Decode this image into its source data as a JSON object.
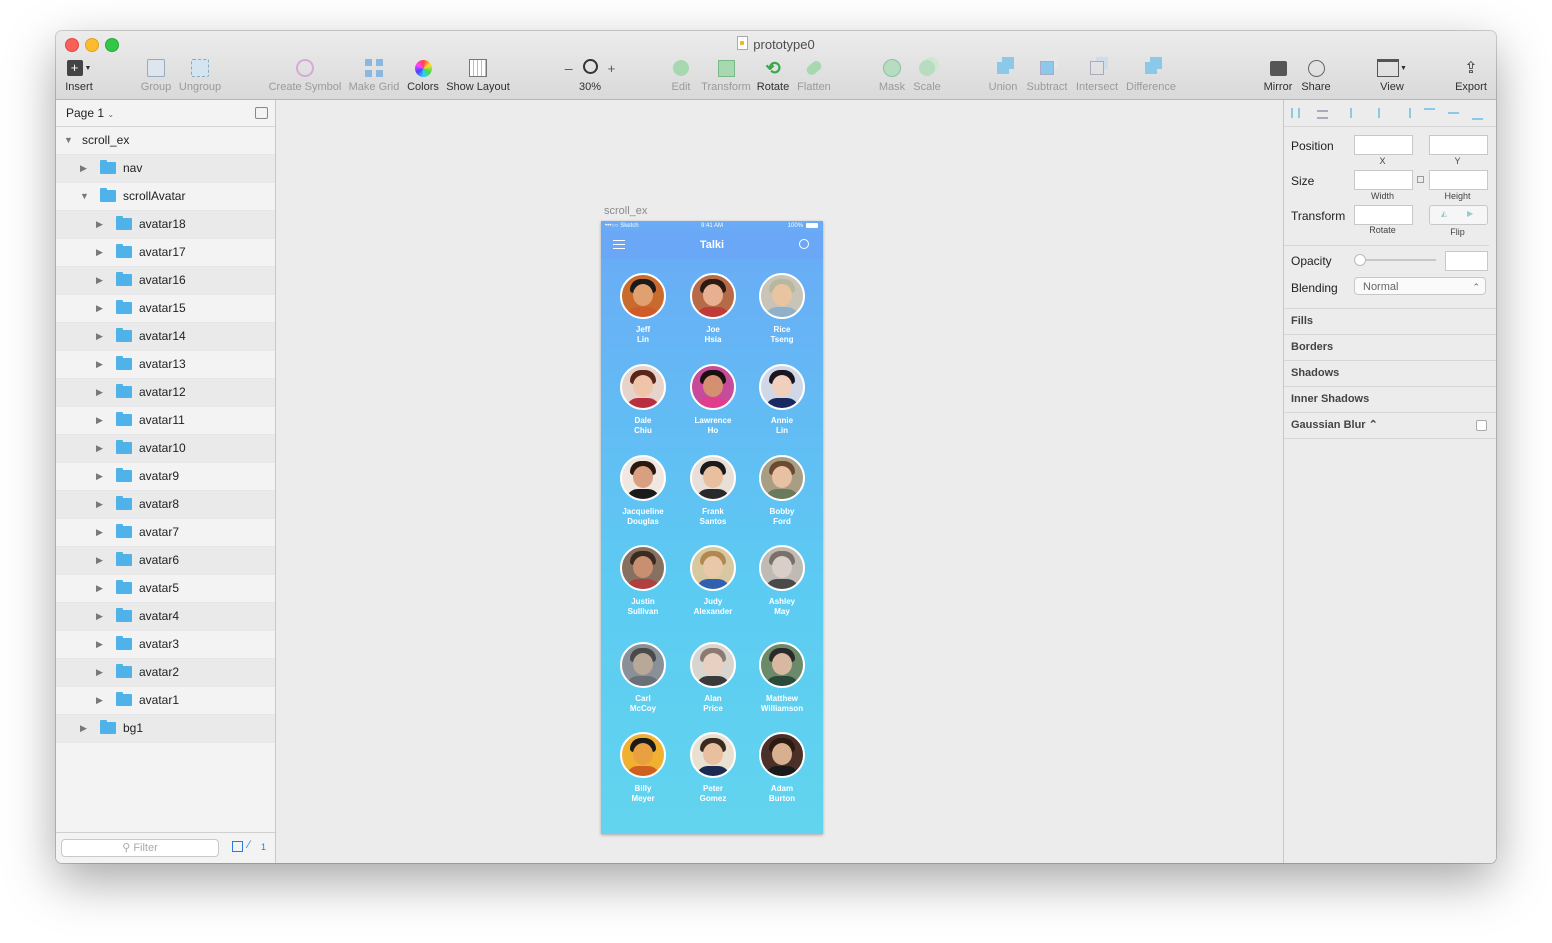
{
  "window": {
    "title": "prototype0"
  },
  "toolbar": {
    "insert": "Insert",
    "group": "Group",
    "ungroup": "Ungroup",
    "create_symbol": "Create Symbol",
    "make_grid": "Make Grid",
    "colors": "Colors",
    "show_layout": "Show Layout",
    "zoom_minus": "–",
    "zoom_plus": "+",
    "zoom": "30%",
    "edit": "Edit",
    "transform": "Transform",
    "rotate": "Rotate",
    "flatten": "Flatten",
    "mask": "Mask",
    "scale": "Scale",
    "union": "Union",
    "subtract": "Subtract",
    "intersect": "Intersect",
    "difference": "Difference",
    "mirror": "Mirror",
    "share": "Share",
    "view": "View",
    "export": "Export"
  },
  "sidebar": {
    "page": "Page 1",
    "layers": [
      {
        "name": "scroll_ex",
        "level": 0,
        "expanded": true,
        "folder": false
      },
      {
        "name": "nav",
        "level": 1,
        "expanded": false,
        "folder": true
      },
      {
        "name": "scrollAvatar",
        "level": 1,
        "expanded": true,
        "folder": true
      },
      {
        "name": "avatar18",
        "level": 2,
        "expanded": false,
        "folder": true
      },
      {
        "name": "avatar17",
        "level": 2,
        "expanded": false,
        "folder": true
      },
      {
        "name": "avatar16",
        "level": 2,
        "expanded": false,
        "folder": true
      },
      {
        "name": "avatar15",
        "level": 2,
        "expanded": false,
        "folder": true
      },
      {
        "name": "avatar14",
        "level": 2,
        "expanded": false,
        "folder": true
      },
      {
        "name": "avatar13",
        "level": 2,
        "expanded": false,
        "folder": true
      },
      {
        "name": "avatar12",
        "level": 2,
        "expanded": false,
        "folder": true
      },
      {
        "name": "avatar11",
        "level": 2,
        "expanded": false,
        "folder": true
      },
      {
        "name": "avatar10",
        "level": 2,
        "expanded": false,
        "folder": true
      },
      {
        "name": "avatar9",
        "level": 2,
        "expanded": false,
        "folder": true
      },
      {
        "name": "avatar8",
        "level": 2,
        "expanded": false,
        "folder": true
      },
      {
        "name": "avatar7",
        "level": 2,
        "expanded": false,
        "folder": true
      },
      {
        "name": "avatar6",
        "level": 2,
        "expanded": false,
        "folder": true
      },
      {
        "name": "avatar5",
        "level": 2,
        "expanded": false,
        "folder": true
      },
      {
        "name": "avatar4",
        "level": 2,
        "expanded": false,
        "folder": true
      },
      {
        "name": "avatar3",
        "level": 2,
        "expanded": false,
        "folder": true
      },
      {
        "name": "avatar2",
        "level": 2,
        "expanded": false,
        "folder": true
      },
      {
        "name": "avatar1",
        "level": 2,
        "expanded": false,
        "folder": true
      },
      {
        "name": "bg1",
        "level": 1,
        "expanded": false,
        "folder": true
      }
    ],
    "filter_placeholder": "Filter",
    "badge_count": "1"
  },
  "canvas": {
    "artboard_name": "scroll_ex",
    "status": {
      "carrier": "•••○○ Sketch",
      "time": "9:41 AM",
      "battery": "100%"
    },
    "app_title": "Talki",
    "contacts": [
      {
        "first": "Jeff",
        "last": "Lin",
        "skin": "#e0a070",
        "hair": "#1a1a1a",
        "shirt": "#d05a2a",
        "bg": "#c86b2d"
      },
      {
        "first": "Joe",
        "last": "Hsia",
        "skin": "#e8b090",
        "hair": "#2a1a12",
        "shirt": "#c03a3a",
        "bg": "#b76a48"
      },
      {
        "first": "Rice",
        "last": "Tseng",
        "skin": "#e9c4a0",
        "hair": "#b8b8a0",
        "shirt": "#8fb0c8",
        "bg": "#c8c4b8"
      },
      {
        "first": "Dale",
        "last": "Chiu",
        "skin": "#f0c4a8",
        "hair": "#5a2418",
        "shirt": "#b83040",
        "bg": "#e6d4cc"
      },
      {
        "first": "Lawrence",
        "last": "Ho",
        "skin": "#d49070",
        "hair": "#1a1010",
        "shirt": "#e23c8c",
        "bg": "#c84a9a"
      },
      {
        "first": "Annie",
        "last": "Lin",
        "skin": "#f0d0bc",
        "hair": "#1a1420",
        "shirt": "#1a2a60",
        "bg": "#d0d8e8"
      },
      {
        "first": "Jacqueline",
        "last": "Douglas",
        "skin": "#d8a080",
        "hair": "#2a1810",
        "shirt": "#1a1a1a",
        "bg": "#f0e8e0"
      },
      {
        "first": "Frank",
        "last": "Santos",
        "skin": "#e8c0a0",
        "hair": "#1a1a1a",
        "shirt": "#2a2a2a",
        "bg": "#e8e0d8"
      },
      {
        "first": "Bobby",
        "last": "Ford",
        "skin": "#e8c0a4",
        "hair": "#6a4a30",
        "shirt": "#6a7a5a",
        "bg": "#a89e84"
      },
      {
        "first": "Justin",
        "last": "Sullivan",
        "skin": "#c89070",
        "hair": "#3a2a20",
        "shirt": "#b04040",
        "bg": "#887060"
      },
      {
        "first": "Judy",
        "last": "Alexander",
        "skin": "#e8c8a8",
        "hair": "#b08850",
        "shirt": "#3060b0",
        "bg": "#d8c8a0"
      },
      {
        "first": "Ashley",
        "last": "May",
        "skin": "#d8d0c8",
        "hair": "#7a7068",
        "shirt": "#4a4a4a",
        "bg": "#c0bab4"
      },
      {
        "first": "Carl",
        "last": "McCoy",
        "skin": "#b8a898",
        "hair": "#4a4a4a",
        "shirt": "#6a7078",
        "bg": "#8a9098"
      },
      {
        "first": "Alan",
        "last": "Price",
        "skin": "#e8d0c0",
        "hair": "#8a7a70",
        "shirt": "#3a3a3a",
        "bg": "#d8d4d0"
      },
      {
        "first": "Matthew",
        "last": "Williamson",
        "skin": "#d8b8a0",
        "hair": "#2a2a2a",
        "shirt": "#2a4a3a",
        "bg": "#6a8a6a"
      },
      {
        "first": "Billy",
        "last": "Meyer",
        "skin": "#e8a040",
        "hair": "#1a1a1a",
        "shirt": "#d06020",
        "bg": "#f0b030"
      },
      {
        "first": "Peter",
        "last": "Gomez",
        "skin": "#e8c0a0",
        "hair": "#3a2a20",
        "shirt": "#1a2a50",
        "bg": "#e8e0d0"
      },
      {
        "first": "Adam",
        "last": "Burton",
        "skin": "#d8b090",
        "hair": "#2a1a10",
        "shirt": "#1a1a1a",
        "bg": "#4a3028"
      }
    ]
  },
  "inspector": {
    "position": "Position",
    "x": "X",
    "y": "Y",
    "size": "Size",
    "width": "Width",
    "height": "Height",
    "transform": "Transform",
    "rotate": "Rotate",
    "flip": "Flip",
    "opacity": "Opacity",
    "blending": "Blending",
    "blending_value": "Normal",
    "fills": "Fills",
    "borders": "Borders",
    "shadows": "Shadows",
    "inner_shadows": "Inner Shadows",
    "gaussian_blur": "Gaussian Blur ⌃"
  }
}
